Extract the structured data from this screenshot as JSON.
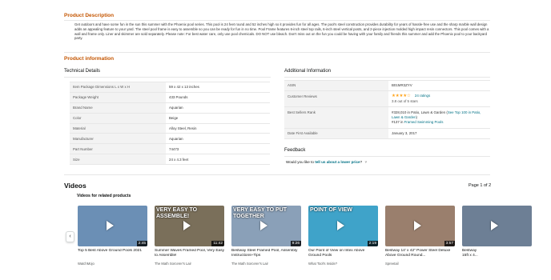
{
  "description": {
    "heading": "Product Description",
    "text": "Get outdoors and have some fun in the sun this summer with the Phoenix pool series. This pool is 24 feet round and 52 inches high so it provides fun for all ages. The pool's steel construction provides durability for years of hassle-free use and the sharp marble wall design adds an appealing feature to your yard. The steel pool frame is easy to assemble so you can be ready for fun in no time. Pool Frame features 6-inch steel top rails, 6-inch steel vertical posts, and 2-piece injection molded high impact resin connectors. This pool comes with a wall and frame only. Liner and skimmer are sold separately. Please note: For best water care, only use pool chemicals. DO NOT use bleach. Don't miss out on the fun you could be having with your family and friends this summer and add the Phoenix pool to your backyard party."
  },
  "product_info": {
    "heading": "Product information",
    "technical_title": "Technical Details",
    "technical_rows": [
      {
        "key": "Item Package Dimensions L x W x H",
        "value": "59 x 42 x 13 inches"
      },
      {
        "key": "Package Weight",
        "value": "433 Pounds"
      },
      {
        "key": "Brand Name",
        "value": "Aquarian"
      },
      {
        "key": "Color",
        "value": "Beige"
      },
      {
        "key": "Material",
        "value": "Alloy Steel, Resin"
      },
      {
        "key": "Manufacturer",
        "value": "Aquarian"
      },
      {
        "key": "Part Number",
        "value": "74473"
      },
      {
        "key": "Size",
        "value": "24 x 4.3 feet"
      }
    ],
    "additional_title": "Additional Information",
    "additional": {
      "asin_label": "ASIN",
      "asin_value": "B01MR3ZYV",
      "reviews_label": "Customer Reviews",
      "stars": "★★★★☆",
      "rating_count": "24 ratings",
      "rating_text": "3.8 out of 5 stars",
      "bsr_label": "Best Sellers Rank",
      "bsr_line1_prefix": "#328,010 in Patio, Lawn & Garden (",
      "bsr_line1_link": "See Top 100 in Patio, Lawn & Garden",
      "bsr_line1_suffix": ")",
      "bsr_line2_prefix": "#137 in ",
      "bsr_line2_link": "Framed Swimming Pools",
      "date_label": "Date First Available",
      "date_value": "January 3, 2017"
    },
    "feedback_title": "Feedback",
    "feedback_prefix": "Would you like to ",
    "feedback_link": "tell us about a lower price",
    "feedback_suffix": "?",
    "feedback_chevron": "˅"
  },
  "videos": {
    "title": "Videos",
    "page_count": "Page 1 of 2",
    "related_title": "Videos for related products",
    "prev_label": "‹",
    "next_label": "›",
    "items": [
      {
        "title": "Top 5 Best Above Ground Pools 2021",
        "source": "WatchMojo",
        "duration": "2:45",
        "overlay": "",
        "bg": "#6b8fb5"
      },
      {
        "title": "Summer Waves Framed Pool, Very Easy to Assemble!",
        "source": "The Math Sorcerer's Lair",
        "duration": "11:42",
        "overlay": "VERY EASY TO ASSEMBLE!",
        "bg": "#7a6f5a"
      },
      {
        "title": "Bestway Steel Framed Pool, Assembly Instructions+Tips",
        "source": "The Math Sorcerer's Lair",
        "duration": "9:26",
        "overlay": "VERY EASY TO PUT TOGETHER",
        "bg": "#8aa0b8"
      },
      {
        "title": "Our Point of View on Intex Above Ground Pools",
        "source": "What Tool's Inside?",
        "duration": "2:19",
        "overlay": "POINT OF VIEW",
        "bg": "#3fa3c9"
      },
      {
        "title": "Bestway 14' x 42\" Power Steel Deluxe Above Ground Round...",
        "source": "Spreetail",
        "duration": "3:57",
        "overlay": "",
        "bg": "#9a7f6d"
      },
      {
        "title": "Bestway 15ft x 4...",
        "source": "",
        "duration": "",
        "overlay": "",
        "bg": "#6d7f95"
      }
    ]
  }
}
